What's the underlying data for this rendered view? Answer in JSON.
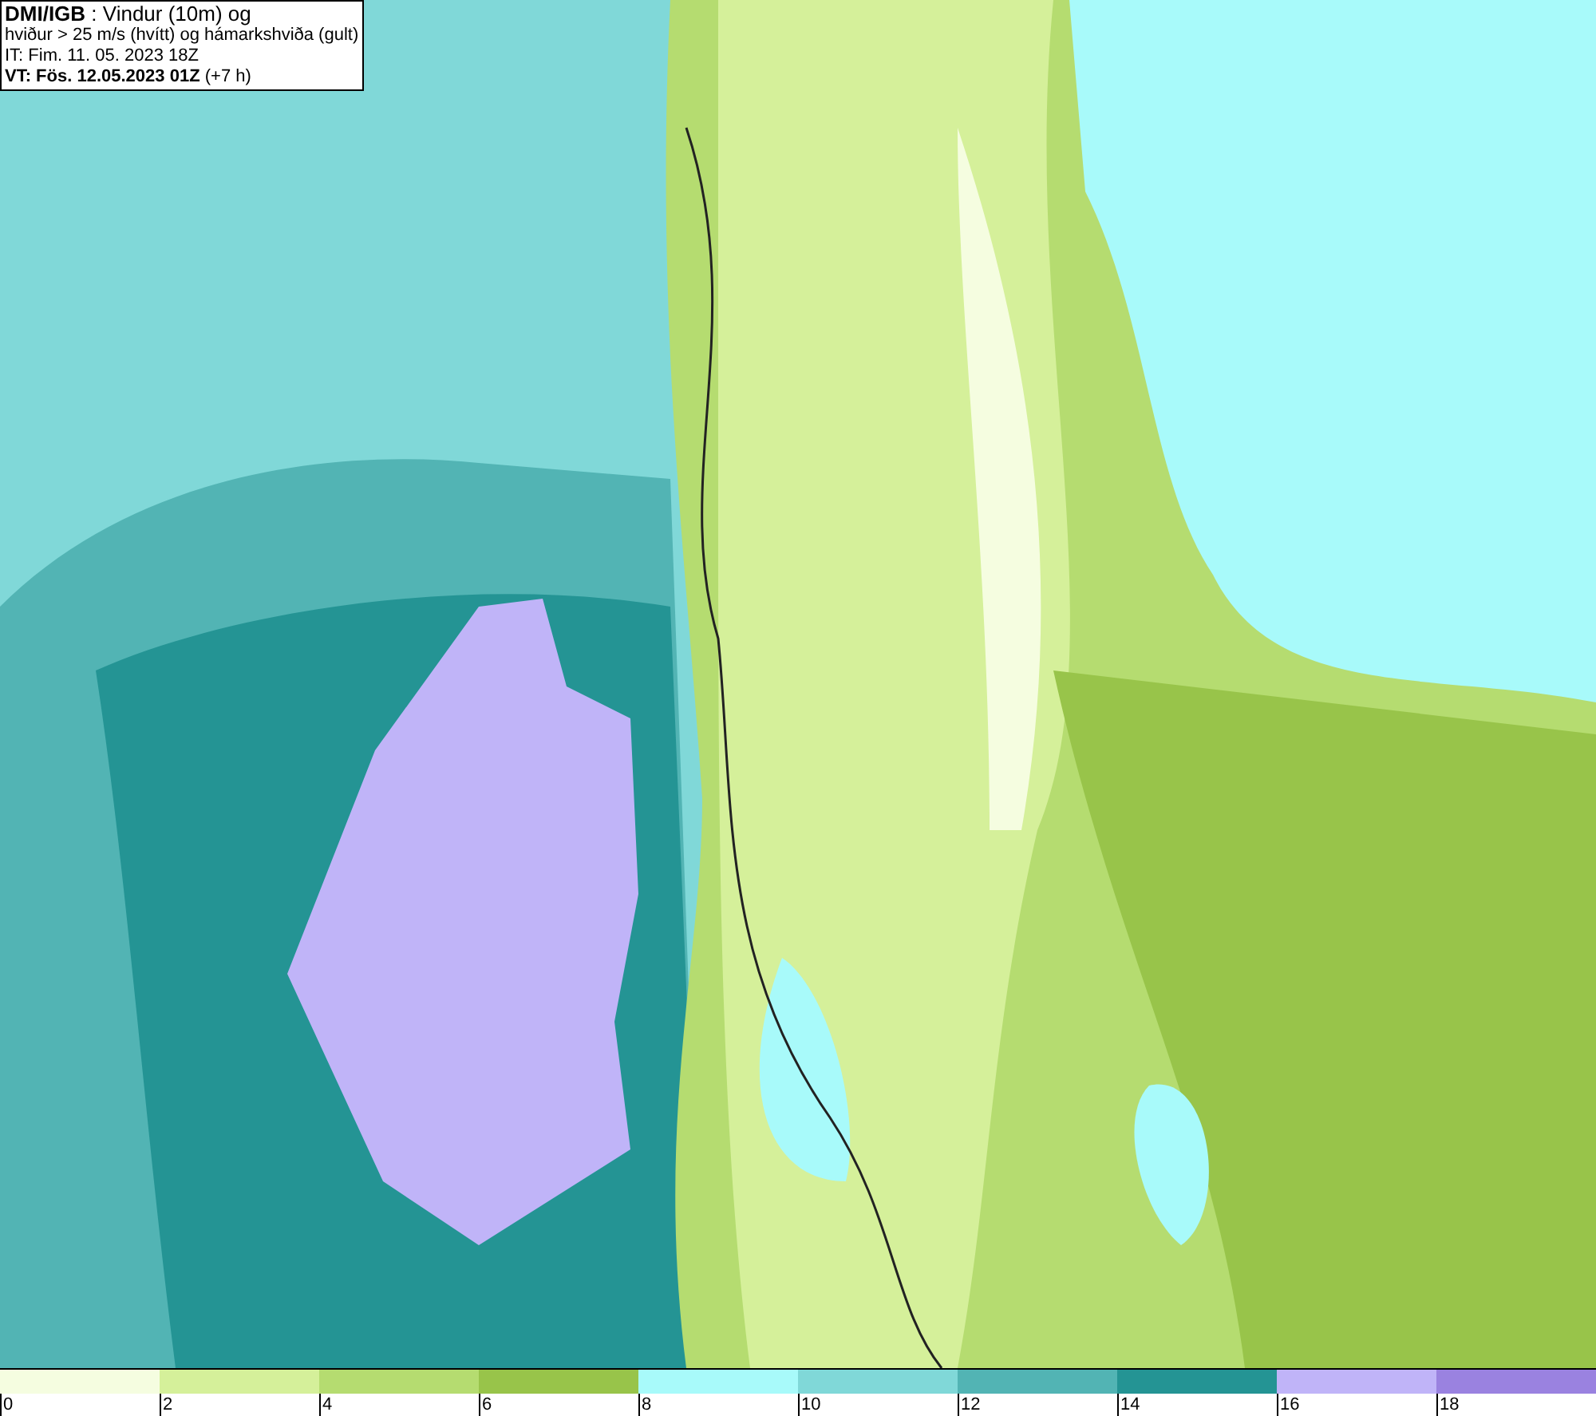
{
  "title_box": {
    "lines": [
      "**DMI/IGB** : Vindur (10m) og",
      "hviður > 25 m/s (hvítt) og hámarkshviða (gult)",
      "IT: Fim. 11. 05. 2023 18Z",
      "**VT: Fös. 12.05.2023 01Z** (+7 h)"
    ]
  },
  "legend": [
    {
      "label": "0",
      "color": "#f5fde0"
    },
    {
      "label": "2",
      "color": "#d5f09a"
    },
    {
      "label": "4",
      "color": "#b5dc70"
    },
    {
      "label": "6",
      "color": "#98c44a"
    },
    {
      "label": "8",
      "color": "#a8fafa"
    },
    {
      "label": "10",
      "color": "#80d8d8"
    },
    {
      "label": "12",
      "color": "#52b4b4"
    },
    {
      "label": "14",
      "color": "#249494"
    },
    {
      "label": "16",
      "color": "#c0b4f8"
    },
    {
      "label": "18",
      "color": "#9a82e0"
    }
  ]
}
